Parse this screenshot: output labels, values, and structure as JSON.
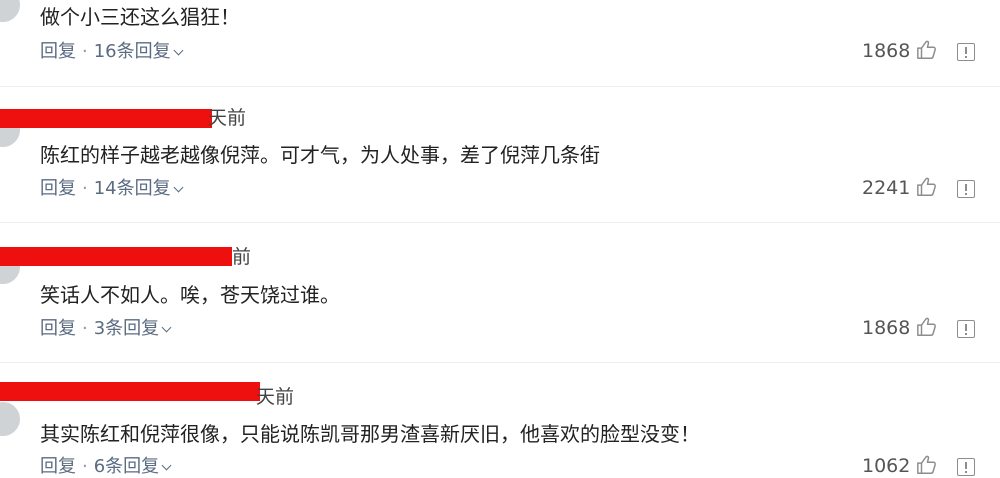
{
  "comments": [
    {
      "time": "",
      "text": "做个小三还这么猖狂！",
      "reply_label": "回复",
      "separator": "·",
      "replies": "16条回复",
      "likes": "1868"
    },
    {
      "time": "天前",
      "text": "陈红的样子越老越像倪萍。可才气，为人处事，差了倪萍几条街",
      "reply_label": "回复",
      "separator": "·",
      "replies": "14条回复",
      "likes": "2241"
    },
    {
      "time": "前",
      "text": "笑话人不如人。唉，苍天饶过谁。",
      "reply_label": "回复",
      "separator": "·",
      "replies": "3条回复",
      "likes": "1868"
    },
    {
      "time": "天前",
      "text": "其实陈红和倪萍很像，只能说陈凯哥那男渣喜新厌旧，他喜欢的脸型没变！",
      "reply_label": "回复",
      "separator": "·",
      "replies": "6条回复",
      "likes": "1062"
    }
  ],
  "colors": {
    "redaction": "#ee0f0f",
    "meta": "#5b6b82",
    "text": "#222222"
  }
}
